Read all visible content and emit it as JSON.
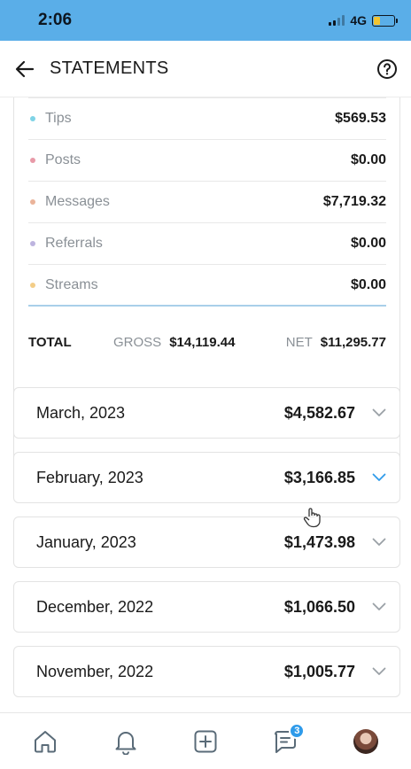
{
  "status_bar": {
    "time": "2:06",
    "network": "4G"
  },
  "header": {
    "title": "STATEMENTS"
  },
  "summary": {
    "rows": [
      {
        "label": "Tips",
        "value": "$569.53",
        "color": "#7fd3e6"
      },
      {
        "label": "Posts",
        "value": "$0.00",
        "color": "#e89aa8"
      },
      {
        "label": "Messages",
        "value": "$7,719.32",
        "color": "#eab39a"
      },
      {
        "label": "Referrals",
        "value": "$0.00",
        "color": "#bdb4df"
      },
      {
        "label": "Streams",
        "value": "$0.00",
        "color": "#f3cd87"
      }
    ],
    "total": {
      "label": "TOTAL",
      "gross_label": "GROSS",
      "gross_value": "$14,119.44",
      "net_label": "NET",
      "net_value": "$11,295.77"
    }
  },
  "months": [
    {
      "name": "March, 2023",
      "amount": "$4,582.67",
      "expanded": false
    },
    {
      "name": "February, 2023",
      "amount": "$3,166.85",
      "expanded": true
    },
    {
      "name": "January, 2023",
      "amount": "$1,473.98",
      "expanded": false
    },
    {
      "name": "December, 2022",
      "amount": "$1,066.50",
      "expanded": false
    },
    {
      "name": "November, 2022",
      "amount": "$1,005.77",
      "expanded": false
    }
  ],
  "nav": {
    "messages_badge": "3"
  },
  "colors": {
    "accent": "#2f9bea",
    "status_bar": "#5aaee8",
    "chevron": "#9aa0a6"
  }
}
